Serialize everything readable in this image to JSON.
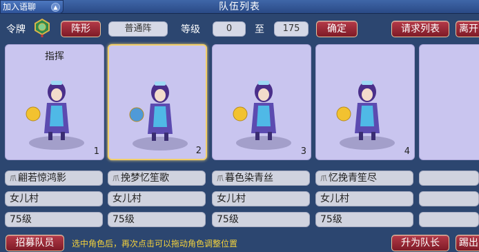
{
  "chat_tab": {
    "label": "加入语聊",
    "icon": "chevron-up-icon"
  },
  "window": {
    "title": "队伍列表"
  },
  "controls": {
    "token_label": "令牌",
    "formation_button": "阵形",
    "formation_value": "普通阵",
    "level_label": "等级",
    "level_min": "0",
    "level_to": "至",
    "level_max": "175",
    "confirm_button": "确定",
    "request_list_button": "请求列表",
    "leave_button": "离开"
  },
  "members": [
    {
      "slot": "1",
      "role_tag": "指挥",
      "name": "翩若惊鸿影",
      "school": "女儿村",
      "level": "75级",
      "selected": false,
      "weapon_color": "#f2c230"
    },
    {
      "slot": "2",
      "role_tag": "",
      "name": "挽梦忆笙歌",
      "school": "女儿村",
      "level": "75级",
      "selected": true,
      "weapon_color": "#4f9ad8"
    },
    {
      "slot": "3",
      "role_tag": "",
      "name": "暮色染青丝",
      "school": "女儿村",
      "level": "75级",
      "selected": false,
      "weapon_color": "#f2c230"
    },
    {
      "slot": "4",
      "role_tag": "",
      "name": "忆挽青笙尽",
      "school": "女儿村",
      "level": "75级",
      "selected": false,
      "weapon_color": "#f2c230"
    }
  ],
  "name_badge": "爪",
  "footer": {
    "recruit_button": "招募队员",
    "hint": "选中角色后，再次点击可以拖动角色调整位置",
    "promote_button": "升为队长",
    "kick_button": "踢出"
  },
  "colors": {
    "background": "#2c4670",
    "card": "#c9c5ef",
    "button_red": "#9a2a36",
    "hint_text": "#f4d23c",
    "selected_border": "#f2cf6a"
  }
}
